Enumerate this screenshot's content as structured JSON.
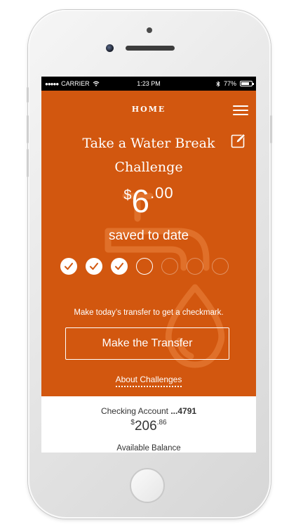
{
  "status_bar": {
    "carrier": "CARRIER",
    "time": "1:23 PM",
    "battery": "77%"
  },
  "nav": {
    "title": "HOME"
  },
  "challenge": {
    "title_line1": "Take a Water Break",
    "title_line2": "Challenge",
    "amount_currency": "$",
    "amount_whole": "6",
    "amount_cents": ".00",
    "saved_label": "saved to date",
    "checkmarks_completed": 3,
    "checkmarks_total": 7,
    "hint": "Make today’s transfer to get a checkmark.",
    "transfer_button": "Make the Transfer",
    "about_link": "About Challenges"
  },
  "account": {
    "name": "Checking Account",
    "number": "...4791",
    "balance_currency": "$",
    "balance_whole": "206",
    "balance_cents": ".86",
    "balance_label": "Available Balance"
  },
  "colors": {
    "brand_orange": "#d2570f",
    "watermark_orange": "#e0702a"
  },
  "icons": {
    "menu": "hamburger-menu-icon",
    "edit": "pencil-edit-icon",
    "check": "checkmark-icon",
    "watermark": "faucet-drop-icon"
  }
}
